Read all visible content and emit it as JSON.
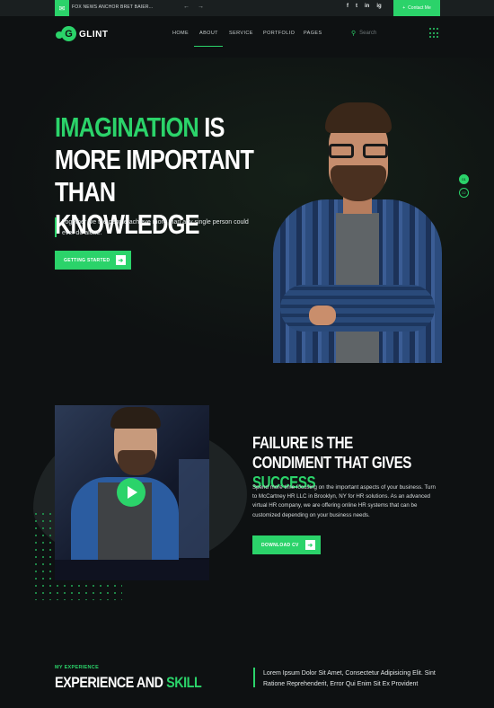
{
  "topbar": {
    "news_icon": "chat-icon",
    "news_text": "FOX NEWS ANCHOR BRET BAIER...",
    "prev": "←",
    "next": "→",
    "social": [
      "f",
      "t",
      "in",
      "ig"
    ],
    "contact_label": "Contact Me"
  },
  "nav": {
    "logo_letter": "G",
    "logo_text": "GLINT",
    "items": [
      "HOME",
      "ABOUT",
      "SERVICE",
      "PORTFOLIO",
      "PAGES"
    ],
    "active": "ABOUT",
    "search_placeholder": "Search"
  },
  "hero": {
    "title_green": "IMAGINATION",
    "title_rest": " IS MORE IMPORTANT THAN KNOWLEDGE",
    "text": "Together we the people achieve more than any single person could ever do alone.",
    "button": "GETTING STARTED",
    "slides": [
      "01",
      "02"
    ],
    "active_slide": "01"
  },
  "about": {
    "title_white": "FAILURE IS THE CONDIMENT THAT GIVES ",
    "title_green": "SUCCESS",
    "text": "Spend more time focusing on the important aspects of your business. Turn to McCartney HR LLC in Brooklyn, NY for HR solutions. As an advanced virtual HR company, we are offering online HR systems that can be customized depending on your business needs.",
    "button": "DOWNLOAD CV"
  },
  "experience": {
    "kicker": "MY EXPERIENCE",
    "title_white": "EXPERIENCE AND ",
    "title_green": "SKILL",
    "text": "Lorem Ipsum Dolor Sit Amet, Consectetur Adipisicing Elit. Sint Ratione Reprehenderit, Error Qui Enim Sit Ex Provident"
  },
  "colors": {
    "accent": "#2bd36a",
    "background": "#0e1112"
  }
}
